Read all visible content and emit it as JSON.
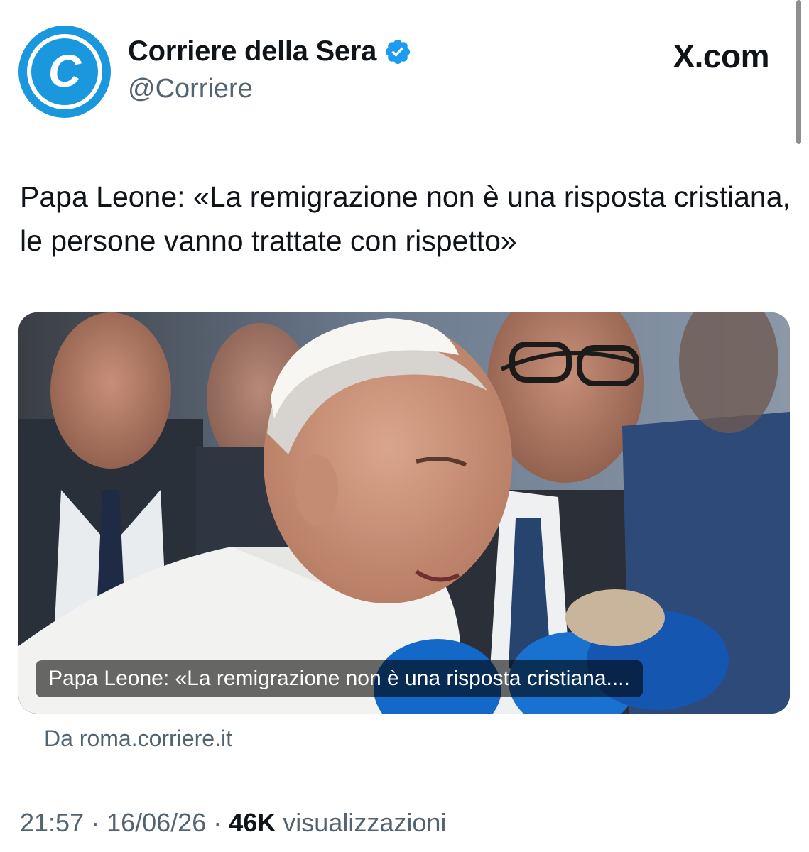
{
  "account": {
    "display_name": "Corriere della Sera",
    "handle": "@Corriere",
    "avatar_letter": "C",
    "verified": true,
    "brand_color": "#1b97dd",
    "verified_color": "#1d9bf0"
  },
  "site": {
    "logo_text": "X.com"
  },
  "tweet": {
    "text": "Papa Leone: «La remigrazione non è una risposta cristiana, le persone vanno trattate con rispetto»",
    "media": {
      "caption": "Papa Leone: «La remigrazione non è una risposta cristiana....",
      "source": "Da roma.corriere.it"
    },
    "time": "21:57",
    "date": "16/06/26",
    "views_count": "46K",
    "views_label": "visualizzazioni",
    "separator": " · "
  },
  "icons": [
    "corriere-c-logo-icon",
    "verified-badge-icon"
  ]
}
